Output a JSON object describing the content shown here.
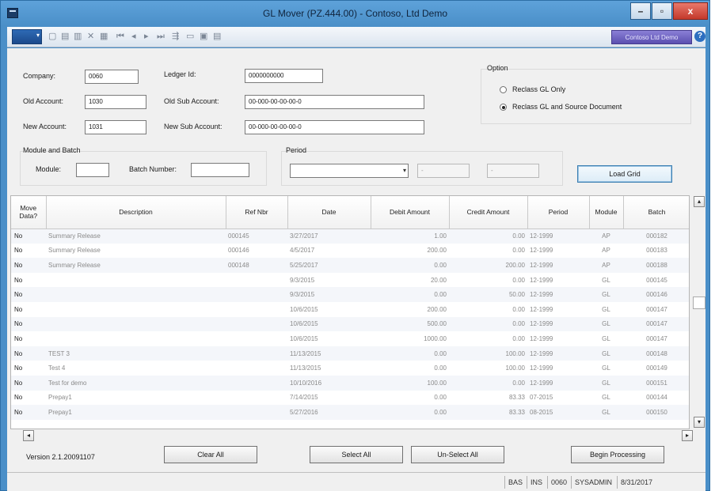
{
  "window": {
    "title": "GL Mover (PZ.444.00) - Contoso, Ltd Demo",
    "minimize": "–",
    "maximize": "▫",
    "close": "x"
  },
  "toolbar": {
    "brand": "Contoso Ltd Demo",
    "help": "?",
    "icons": [
      "new-icon",
      "save-icon",
      "copy-icon",
      "delete-icon",
      "grid-icon",
      "first-icon",
      "prev-icon",
      "next-icon",
      "last-icon",
      "attach-icon",
      "note-icon",
      "print-icon",
      "report-icon"
    ]
  },
  "form": {
    "company_label": "Company:",
    "company_value": "0060",
    "ledger_label": "Ledger Id:",
    "ledger_value": "0000000000",
    "old_account_label": "Old Account:",
    "old_account_value": "1030",
    "old_sub_label": "Old Sub Account:",
    "old_sub_value": "00-000-00-00-00-0",
    "new_account_label": "New Account:",
    "new_account_value": "1031",
    "new_sub_label": "New Sub Account:",
    "new_sub_value": "00-000-00-00-00-0",
    "module_batch_label": "Module and Batch",
    "module_label": "Module:",
    "module_value": "",
    "batch_label": "Batch Number:",
    "batch_value": "",
    "period_label": "Period",
    "period_value": "",
    "period_from": "-",
    "period_to": "-",
    "option_label": "Option",
    "option_gl_only": "Reclass GL Only",
    "option_gl_source": "Reclass GL and Source Document",
    "load_grid": "Load Grid"
  },
  "grid": {
    "columns": [
      "Move Data?",
      "Description",
      "Ref Nbr",
      "Date",
      "Debit Amount",
      "Credit Amount",
      "Period",
      "Module",
      "Batch"
    ],
    "rows": [
      [
        "No",
        "Summary Release",
        "000145",
        "3/27/2017",
        "1.00",
        "0.00",
        "12-1999",
        "AP",
        "000182"
      ],
      [
        "No",
        "Summary Release",
        "000146",
        "4/5/2017",
        "200.00",
        "0.00",
        "12-1999",
        "AP",
        "000183"
      ],
      [
        "No",
        "Summary Release",
        "000148",
        "5/25/2017",
        "0.00",
        "200.00",
        "12-1999",
        "AP",
        "000188"
      ],
      [
        "No",
        "",
        "",
        "9/3/2015",
        "20.00",
        "0.00",
        "12-1999",
        "GL",
        "000145"
      ],
      [
        "No",
        "",
        "",
        "9/3/2015",
        "0.00",
        "50.00",
        "12-1999",
        "GL",
        "000146"
      ],
      [
        "No",
        "",
        "",
        "10/6/2015",
        "200.00",
        "0.00",
        "12-1999",
        "GL",
        "000147"
      ],
      [
        "No",
        "",
        "",
        "10/6/2015",
        "500.00",
        "0.00",
        "12-1999",
        "GL",
        "000147"
      ],
      [
        "No",
        "",
        "",
        "10/6/2015",
        "1000.00",
        "0.00",
        "12-1999",
        "GL",
        "000147"
      ],
      [
        "No",
        "TEST 3",
        "",
        "11/13/2015",
        "0.00",
        "100.00",
        "12-1999",
        "GL",
        "000148"
      ],
      [
        "No",
        "Test 4",
        "",
        "11/13/2015",
        "0.00",
        "100.00",
        "12-1999",
        "GL",
        "000149"
      ],
      [
        "No",
        "Test for demo",
        "",
        "10/10/2016",
        "100.00",
        "0.00",
        "12-1999",
        "GL",
        "000151"
      ],
      [
        "No",
        "Prepay1",
        "",
        "7/14/2015",
        "0.00",
        "83.33",
        "07-2015",
        "GL",
        "000144"
      ],
      [
        "No",
        "Prepay1",
        "",
        "5/27/2016",
        "0.00",
        "83.33",
        "08-2015",
        "GL",
        "000150"
      ]
    ]
  },
  "footer": {
    "version": "Version 2.1.20091107",
    "clear_all": "Clear All",
    "select_all": "Select All",
    "unselect_all": "Un-Select All",
    "begin_processing": "Begin Processing"
  },
  "status": {
    "mode": "BAS",
    "ins": "INS",
    "company": "0060",
    "user": "SYSADMIN",
    "date": "8/31/2017"
  }
}
